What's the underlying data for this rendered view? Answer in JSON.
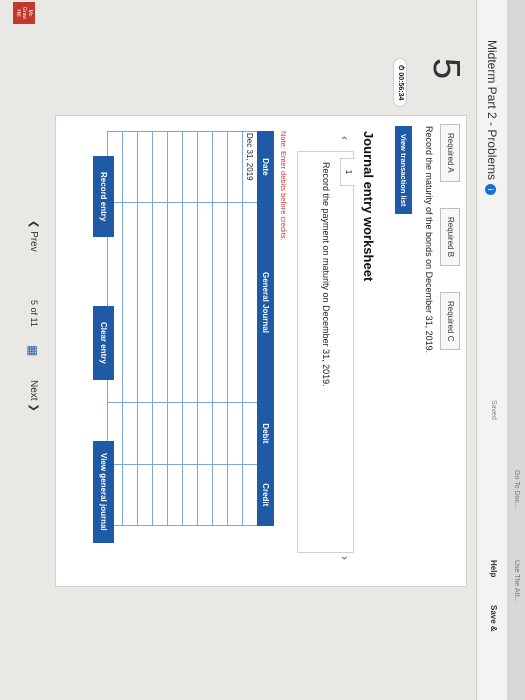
{
  "topbar": {
    "tab1": "Use The Att...",
    "tab2": "Go To Doc..."
  },
  "header": {
    "title": "Midterm Part 2 - Problems",
    "saved": "Saved",
    "help": "Help",
    "save_exit": "Save &"
  },
  "sidebar": {
    "question_number": "5",
    "timer": "00:56:34"
  },
  "tabs": [
    {
      "label": "Required A"
    },
    {
      "label": "Required B"
    },
    {
      "label": "Required C"
    }
  ],
  "instruction": "Record the maturity of the bonds on December 31, 2019.",
  "view_transaction_list": "View transaction list",
  "worksheet": {
    "title": "Journal entry worksheet",
    "transaction_tab": "1",
    "transaction_desc": "Record the payment on maturity on December 31, 2019.",
    "note": "Note: Enter debits before credits.",
    "columns": [
      "Date",
      "General Journal",
      "Debit",
      "Credit"
    ],
    "first_date": "Dec 31, 2019"
  },
  "buttons": {
    "record": "Record entry",
    "clear": "Clear entry",
    "view_journal": "View general journal"
  },
  "footer": {
    "prev": "❮ Prev",
    "position": "5 of 11",
    "next": "Next ❯"
  },
  "logo": {
    "line1": "Mc",
    "line2": "Graw",
    "line3": "Hill"
  },
  "colors": {
    "primary": "#1f5aa6",
    "note": "#c0392b"
  }
}
